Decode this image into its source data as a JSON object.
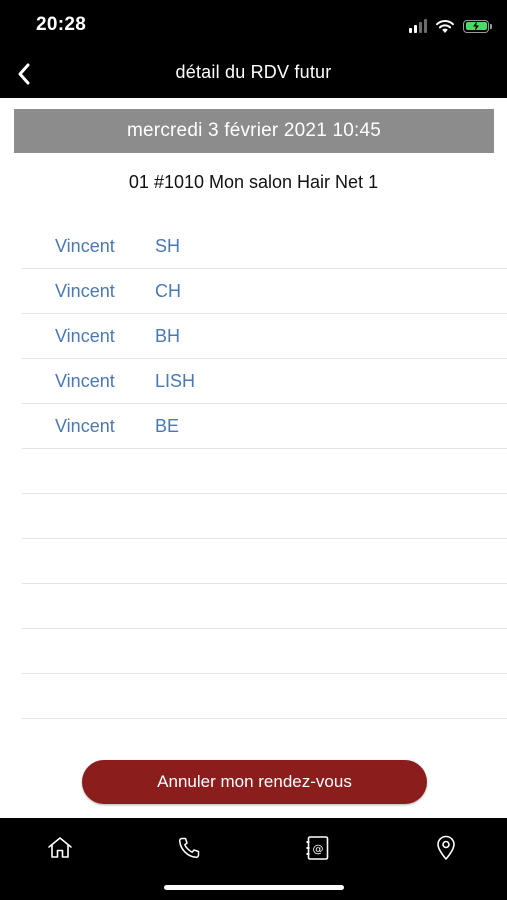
{
  "status_bar": {
    "time": "20:28",
    "icons": [
      "cellular-signal-icon",
      "wifi-icon",
      "battery-charging-icon"
    ],
    "battery_color": "#4cd964"
  },
  "nav": {
    "title": "détail du RDV futur",
    "back_icon": "chevron-left-icon"
  },
  "appointment": {
    "datetime": "mercredi 3 février 2021 10:45",
    "salon": "01 #1010 Mon salon Hair Net 1",
    "services": [
      {
        "first": "Vincent",
        "last": "SH"
      },
      {
        "first": "Vincent",
        "last": "CH"
      },
      {
        "first": "Vincent",
        "last": "BH"
      },
      {
        "first": "Vincent",
        "last": "LISH"
      },
      {
        "first": "Vincent",
        "last": "BE"
      }
    ]
  },
  "actions": {
    "cancel_label": "Annuler mon rendez-vous"
  },
  "tab_bar": {
    "items": [
      {
        "icon": "home-icon"
      },
      {
        "icon": "phone-icon"
      },
      {
        "icon": "contact-book-icon"
      },
      {
        "icon": "location-pin-icon"
      }
    ]
  },
  "colors": {
    "bar_background": "#000000",
    "banner_background": "#8c8c8c",
    "service_text": "#4a78b4",
    "cancel_button": "#8b1d1d"
  }
}
